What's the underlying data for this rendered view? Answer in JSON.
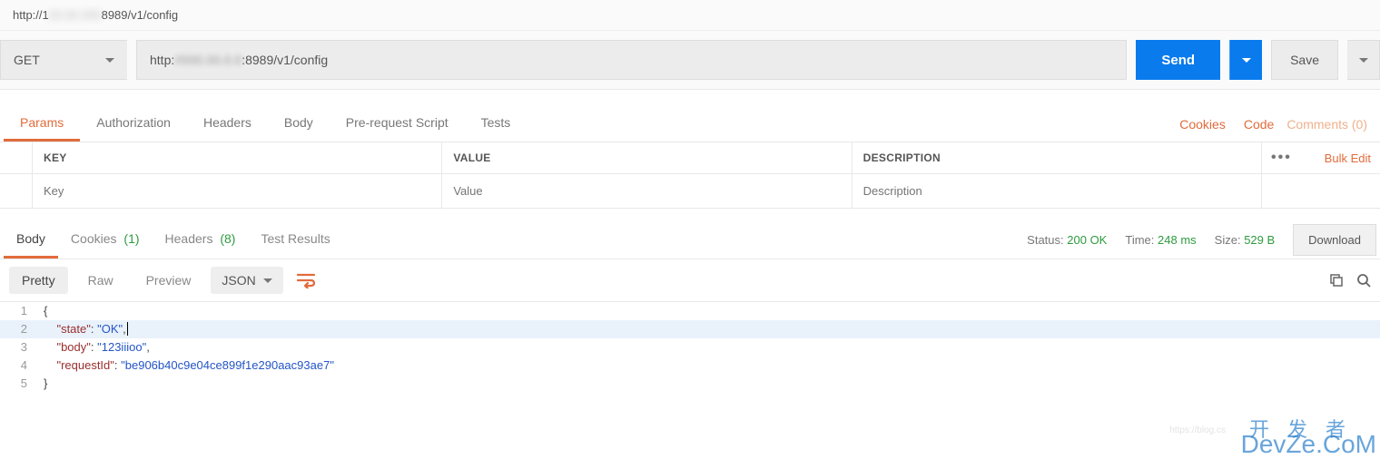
{
  "tab_title_prefix": "http://1",
  "tab_title_suffix": "8989/v1/config",
  "request": {
    "method": "GET",
    "url_prefix": "http:",
    "url_suffix": ":8989/v1/config",
    "send_label": "Send",
    "save_label": "Save"
  },
  "request_tabs": {
    "params": "Params",
    "authorization": "Authorization",
    "headers": "Headers",
    "body": "Body",
    "prerequest": "Pre-request Script",
    "tests": "Tests"
  },
  "right_links": {
    "cookies": "Cookies",
    "code": "Code",
    "comments": "Comments (0)"
  },
  "kv_headers": {
    "key": "KEY",
    "value": "VALUE",
    "description": "DESCRIPTION"
  },
  "kv_placeholders": {
    "key": "Key",
    "value": "Value",
    "description": "Description"
  },
  "bulk_edit": "Bulk Edit",
  "response_tabs": {
    "body": "Body",
    "cookies_label": "Cookies",
    "cookies_count": "(1)",
    "headers_label": "Headers",
    "headers_count": "(8)",
    "test_results": "Test Results"
  },
  "status": {
    "status_label": "Status:",
    "status_value": "200 OK",
    "time_label": "Time:",
    "time_value": "248 ms",
    "size_label": "Size:",
    "size_value": "529 B",
    "download": "Download"
  },
  "viewer": {
    "pretty": "Pretty",
    "raw": "Raw",
    "preview": "Preview",
    "format": "JSON"
  },
  "response_body": {
    "state": "OK",
    "body": "123iiioo",
    "requestId": "be906b40c9e04ce899f1e290aac93ae7"
  },
  "watermark_cn": "开发者",
  "watermark_en": "DevZe.CoM",
  "faint_url": "https://blog.cs"
}
